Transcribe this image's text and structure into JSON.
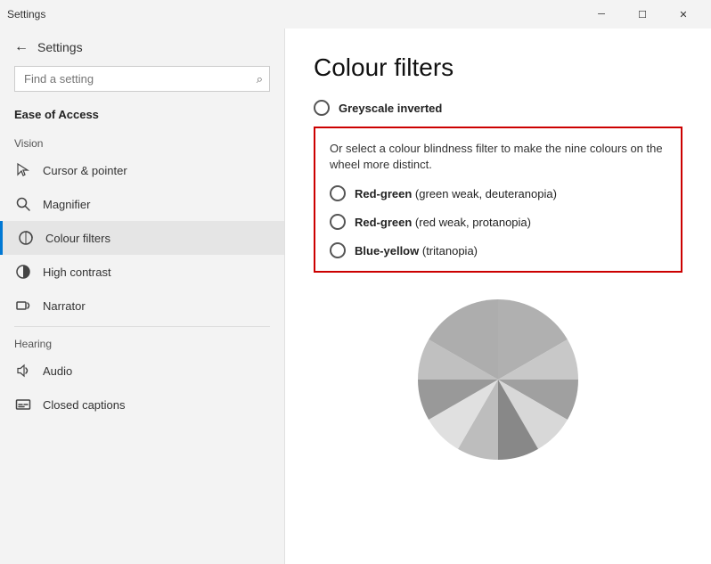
{
  "titleBar": {
    "title": "Settings",
    "minimizeLabel": "─",
    "maximizeLabel": "☐",
    "closeLabel": "✕"
  },
  "sidebar": {
    "backIcon": "←",
    "appTitle": "Settings",
    "search": {
      "placeholder": "Find a setting",
      "icon": "🔍"
    },
    "sectionLabel": "Ease of Access",
    "visionLabel": "Vision",
    "hearingLabel": "Hearing",
    "navItems": [
      {
        "id": "cursor",
        "icon": "👆",
        "label": "Cursor & pointer"
      },
      {
        "id": "magnifier",
        "icon": "🔍",
        "label": "Magnifier"
      },
      {
        "id": "colour-filters",
        "icon": "👁",
        "label": "Colour filters",
        "active": true
      },
      {
        "id": "high-contrast",
        "icon": "☀",
        "label": "High contrast"
      },
      {
        "id": "narrator",
        "icon": "💬",
        "label": "Narrator"
      },
      {
        "id": "audio",
        "icon": "🔊",
        "label": "Audio"
      },
      {
        "id": "closed-captions",
        "icon": "📄",
        "label": "Closed captions"
      }
    ]
  },
  "main": {
    "pageTitle": "Colour filters",
    "greyscaleInvertedLabel": "Greyscale inverted",
    "filterBoxDesc": "Or select a colour blindness filter to make the nine colours on the wheel more distinct.",
    "filterOptions": [
      {
        "id": "red-green-weak",
        "bold": "Red-green",
        "rest": " (green weak, deuteranopia)"
      },
      {
        "id": "red-green-prot",
        "bold": "Red-green",
        "rest": " (red weak, protanopia)"
      },
      {
        "id": "blue-yellow",
        "bold": "Blue-yellow",
        "rest": " (tritanopia)"
      }
    ]
  }
}
